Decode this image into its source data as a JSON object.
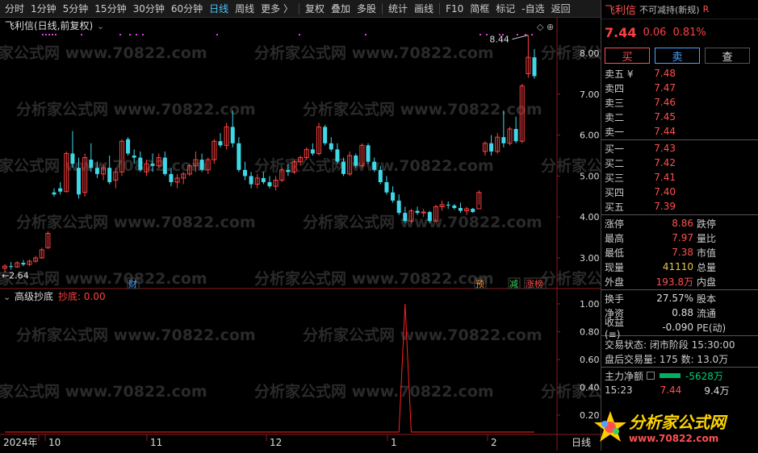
{
  "toolbar": {
    "items": [
      "分时",
      "1分钟",
      "5分钟",
      "15分钟",
      "30分钟",
      "60分钟",
      "日线",
      "周线",
      "更多 〉",
      "复权",
      "叠加",
      "多股",
      "统计",
      "画线",
      "F10",
      "简框",
      "标记",
      "-自选",
      "返回"
    ],
    "active_index": 6
  },
  "main_chart": {
    "title": "飞利信(日线,前复权)",
    "high_label": "8.44",
    "low_label": "←2.64",
    "price_axis": [
      "8.00",
      "7.00",
      "6.00",
      "5.00",
      "4.00",
      "3.00"
    ],
    "event_tags": [
      {
        "text": "财",
        "color": "#4fa3ff"
      },
      {
        "text": "预",
        "color": "#ff9a3c"
      },
      {
        "text": "减",
        "color": "#3ccf5a"
      },
      {
        "text": "涨榜",
        "color": "#ff5050"
      }
    ],
    "watermark": "分析家公式网 www.70822.com"
  },
  "indicator": {
    "name": "高级抄底",
    "series_label": "抄底: 0.00",
    "axis": [
      "1.00",
      "0.80",
      "0.60",
      "0.40",
      "0.20"
    ]
  },
  "date_axis": {
    "labels": [
      "2024年",
      "10",
      "11",
      "12",
      "1",
      "2"
    ],
    "corner": "日线"
  },
  "chart_data": {
    "type": "candlestick",
    "title": "飞利信(日线,前复权)",
    "ylim": [
      2.5,
      8.6
    ],
    "x_months": [
      "2024-09",
      "2024-10",
      "2024-11",
      "2024-12",
      "2025-01",
      "2025-02"
    ],
    "candles_ohlc": [
      [
        2.75,
        2.85,
        2.64,
        2.8
      ],
      [
        2.8,
        2.9,
        2.72,
        2.78
      ],
      [
        2.78,
        2.92,
        2.76,
        2.88
      ],
      [
        2.88,
        2.95,
        2.8,
        2.84
      ],
      [
        2.84,
        2.96,
        2.8,
        2.92
      ],
      [
        2.92,
        3.05,
        2.88,
        3.0
      ],
      [
        3.0,
        3.25,
        2.98,
        3.2
      ],
      [
        3.25,
        3.65,
        3.22,
        3.6
      ],
      [
        4.6,
        4.7,
        4.5,
        4.55
      ],
      [
        4.7,
        4.85,
        4.55,
        4.62
      ],
      [
        4.62,
        5.6,
        4.6,
        5.55
      ],
      [
        5.55,
        6.1,
        5.2,
        5.3
      ],
      [
        5.2,
        5.45,
        4.45,
        4.55
      ],
      [
        4.6,
        5.55,
        4.5,
        5.45
      ],
      [
        5.4,
        5.8,
        5.1,
        5.2
      ],
      [
        5.2,
        5.35,
        4.95,
        5.05
      ],
      [
        5.05,
        5.3,
        4.9,
        5.2
      ],
      [
        5.2,
        5.5,
        4.8,
        4.85
      ],
      [
        4.9,
        5.2,
        4.7,
        5.1
      ],
      [
        5.1,
        5.9,
        5.0,
        5.85
      ],
      [
        5.9,
        5.95,
        5.5,
        5.55
      ],
      [
        5.5,
        5.65,
        5.3,
        5.45
      ],
      [
        5.45,
        5.6,
        5.1,
        5.15
      ],
      [
        5.1,
        5.4,
        5.0,
        5.3
      ],
      [
        5.3,
        5.55,
        5.1,
        5.25
      ],
      [
        5.25,
        5.55,
        5.2,
        5.45
      ],
      [
        5.45,
        5.6,
        5.0,
        5.05
      ],
      [
        5.05,
        5.2,
        4.75,
        4.85
      ],
      [
        4.85,
        5.05,
        4.7,
        4.95
      ],
      [
        4.95,
        5.1,
        4.8,
        5.05
      ],
      [
        5.05,
        5.3,
        5.0,
        5.25
      ],
      [
        5.25,
        5.6,
        5.1,
        5.4
      ],
      [
        5.4,
        5.55,
        5.1,
        5.15
      ],
      [
        5.15,
        5.45,
        5.05,
        5.4
      ],
      [
        5.4,
        5.9,
        5.3,
        5.85
      ],
      [
        5.85,
        6.05,
        5.7,
        5.75
      ],
      [
        5.75,
        6.3,
        5.65,
        6.2
      ],
      [
        6.2,
        6.6,
        5.7,
        5.8
      ],
      [
        5.8,
        5.95,
        5.1,
        5.15
      ],
      [
        5.15,
        5.35,
        4.9,
        5.0
      ],
      [
        5.0,
        5.1,
        4.7,
        4.8
      ],
      [
        4.8,
        5.05,
        4.7,
        4.95
      ],
      [
        4.95,
        5.1,
        4.8,
        4.85
      ],
      [
        4.85,
        5.0,
        4.7,
        4.75
      ],
      [
        4.75,
        5.0,
        4.65,
        4.9
      ],
      [
        4.9,
        5.2,
        4.85,
        5.15
      ],
      [
        5.15,
        5.3,
        5.0,
        5.1
      ],
      [
        5.1,
        5.4,
        5.05,
        5.35
      ],
      [
        5.35,
        5.5,
        5.25,
        5.45
      ],
      [
        5.45,
        5.7,
        5.4,
        5.65
      ],
      [
        5.65,
        5.8,
        5.5,
        5.55
      ],
      [
        5.55,
        6.3,
        5.5,
        6.2
      ],
      [
        6.2,
        6.25,
        5.75,
        5.8
      ],
      [
        5.8,
        5.95,
        5.6,
        5.65
      ],
      [
        5.65,
        5.8,
        5.3,
        5.35
      ],
      [
        5.35,
        5.45,
        5.0,
        5.05
      ],
      [
        5.05,
        5.6,
        5.0,
        5.5
      ],
      [
        5.5,
        5.55,
        5.2,
        5.25
      ],
      [
        5.25,
        5.8,
        5.2,
        5.75
      ],
      [
        5.75,
        5.8,
        5.3,
        5.35
      ],
      [
        5.35,
        5.45,
        5.1,
        5.15
      ],
      [
        5.15,
        5.25,
        4.8,
        4.85
      ],
      [
        4.85,
        5.0,
        4.55,
        4.6
      ],
      [
        4.6,
        4.75,
        4.35,
        4.4
      ],
      [
        4.4,
        4.55,
        4.05,
        4.1
      ],
      [
        4.1,
        4.25,
        3.85,
        3.9
      ],
      [
        3.9,
        4.2,
        3.85,
        4.15
      ],
      [
        4.15,
        4.25,
        4.05,
        4.1
      ],
      [
        4.1,
        4.2,
        4.0,
        4.12
      ],
      [
        4.12,
        4.15,
        3.85,
        3.9
      ],
      [
        3.9,
        4.3,
        3.88,
        4.25
      ],
      [
        4.25,
        4.4,
        4.15,
        4.3
      ],
      [
        4.3,
        4.38,
        4.2,
        4.28
      ],
      [
        4.28,
        4.32,
        4.18,
        4.22
      ],
      [
        4.22,
        4.35,
        4.1,
        4.15
      ],
      [
        4.15,
        4.25,
        4.05,
        4.2
      ],
      [
        4.2,
        4.22,
        4.1,
        4.12
      ],
      [
        4.2,
        4.65,
        4.3,
        4.6
      ],
      [
        5.6,
        5.85,
        5.5,
        5.8
      ],
      [
        5.8,
        6.0,
        5.5,
        5.6
      ],
      [
        5.6,
        6.05,
        5.55,
        5.95
      ],
      [
        5.95,
        6.6,
        5.7,
        5.8
      ],
      [
        5.8,
        6.2,
        5.75,
        6.15
      ],
      [
        6.15,
        6.45,
        5.8,
        5.85
      ],
      [
        5.85,
        7.25,
        5.8,
        7.2
      ],
      [
        7.5,
        8.44,
        7.4,
        7.9
      ],
      [
        7.9,
        8.1,
        7.38,
        7.44
      ]
    ],
    "indicator_series": {
      "name": "抄底",
      "values": [
        0,
        0,
        0,
        0,
        0,
        0,
        0,
        0,
        0,
        0,
        0,
        0,
        0,
        0,
        0,
        0,
        0,
        0,
        0,
        0,
        0,
        0,
        0,
        0,
        0,
        0,
        0,
        0,
        0,
        0,
        0,
        0,
        0,
        0,
        0,
        0,
        0,
        0,
        0,
        0,
        0,
        0,
        0,
        0,
        0,
        0,
        0,
        0,
        0,
        0,
        0,
        0,
        0,
        0,
        0,
        0,
        0,
        0,
        0,
        0,
        0,
        0,
        0,
        0,
        0,
        1.0,
        0,
        0,
        0,
        0,
        0,
        0,
        0,
        0,
        0,
        0,
        0,
        0,
        0,
        0,
        0,
        0,
        0,
        0,
        0,
        0,
        0
      ],
      "ylim": [
        0,
        1.0
      ]
    }
  },
  "sidepanel": {
    "name": "飞利信",
    "tag": "不可减持(新规)",
    "r": "R",
    "price": "7.44",
    "change": "0.06",
    "change_pct": "0.81%",
    "buttons": [
      "买",
      "卖",
      "查"
    ],
    "asks": [
      {
        "label": "卖五 ¥",
        "price": "7.48"
      },
      {
        "label": "卖四",
        "price": "7.47"
      },
      {
        "label": "卖三",
        "price": "7.46"
      },
      {
        "label": "卖二",
        "price": "7.45"
      },
      {
        "label": "卖一",
        "price": "7.44"
      }
    ],
    "bids": [
      {
        "label": "买一",
        "price": "7.43"
      },
      {
        "label": "买二",
        "price": "7.42"
      },
      {
        "label": "买三",
        "price": "7.41"
      },
      {
        "label": "买四",
        "price": "7.40"
      },
      {
        "label": "买五",
        "price": "7.39"
      }
    ],
    "stats": [
      {
        "label": "涨停",
        "value": "8.86",
        "cls": "red",
        "label2": "跌停"
      },
      {
        "label": "最高",
        "value": "7.97",
        "cls": "red",
        "label2": "量比"
      },
      {
        "label": "最低",
        "value": "7.38",
        "cls": "red",
        "label2": "市值"
      },
      {
        "label": "现量",
        "value": "41110",
        "cls": "yellow",
        "label2": "总量"
      },
      {
        "label": "外盘",
        "value": "193.8万",
        "cls": "red",
        "label2": "内盘"
      }
    ],
    "stats2": [
      {
        "label": "换手",
        "value": "27.57%",
        "cls": "white",
        "label2": "股本"
      },
      {
        "label": "净资",
        "value": "0.88",
        "cls": "white",
        "label2": "流通"
      },
      {
        "label": "收益(≡)",
        "value": "-0.090",
        "cls": "white",
        "label2": "PE(动)"
      }
    ],
    "status": "交易状态: 闭市阶段 15:30:00",
    "after_hours": "盘后交易量: 175  数: 13.0万",
    "main_flow_label": "主力净额",
    "main_flow_value": "-5628万",
    "tick_time": "15:23",
    "tick_price": "7.44",
    "tick_vol": "9.4万"
  },
  "logo": {
    "text": "分析家公式网",
    "url": "www.70822.com"
  }
}
